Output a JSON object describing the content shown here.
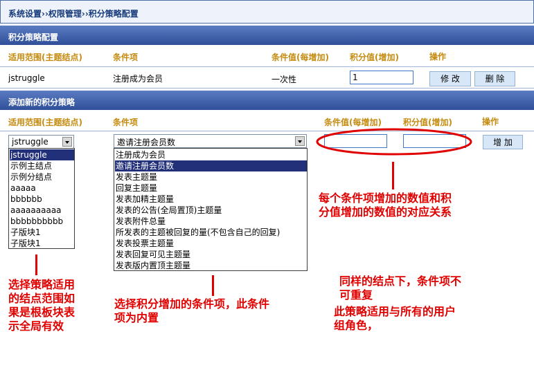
{
  "breadcrumb": "系统设置››权限管理››积分策略配置",
  "config_section": {
    "title": "积分策略配置",
    "columns": [
      "适用范围(主题结点)",
      "条件项",
      "条件值(每增加)",
      "积分值(增加)",
      "操作"
    ],
    "row": {
      "scope": "jstruggle",
      "condition": "注册成为会员",
      "condition_value": "一次性",
      "points_value": "1",
      "modify_label": "修 改",
      "delete_label": "删 除"
    }
  },
  "add_section": {
    "title": "添加新的积分策略",
    "columns": [
      "适用范围(主题结点)",
      "条件项",
      "条件值(每增加)",
      "积分值(增加)",
      "操作"
    ],
    "scope_selected": "jstruggle",
    "condition_selected": "邀请注册会员数",
    "add_label": "增 加",
    "scope_options": [
      "jstruggle",
      "示例主结点",
      "示例分结点",
      "aaaaa",
      "bbbbbb",
      "aaaaaaaaaa",
      "bbbbbbbbbb",
      "子版块1",
      "子版块1"
    ],
    "condition_options": [
      "注册成为会员",
      "邀请注册会员数",
      "发表主题量",
      "回复主题量",
      "发表加精主题量",
      "发表的公告(全局置顶)主题量",
      "发表附件总量",
      "所发表的主题被回复的量(不包含自己的回复)",
      "发表投票主题量",
      "发表回复可见主题量",
      "发表版内置顶主题量"
    ]
  },
  "annotations": {
    "scope_note": [
      "选择策略适用",
      "的结点范围如",
      "果是根板块表",
      "示全局有效"
    ],
    "condition_note": [
      "选择积分增加的条件项，此条件",
      "项为内置"
    ],
    "value_note": [
      "每个条件项增加的数值和积",
      "分值增加的数值的对应关系"
    ],
    "unique_note": [
      "同样的结点下，条件项不",
      "可重复"
    ],
    "roles_note": [
      "此策略适用与所有的用户",
      "组角色，"
    ]
  },
  "colors": {
    "header": "#2f4f98",
    "column_header": "#c58b0f",
    "annotation": "#e00000",
    "selected": "#22307a"
  }
}
